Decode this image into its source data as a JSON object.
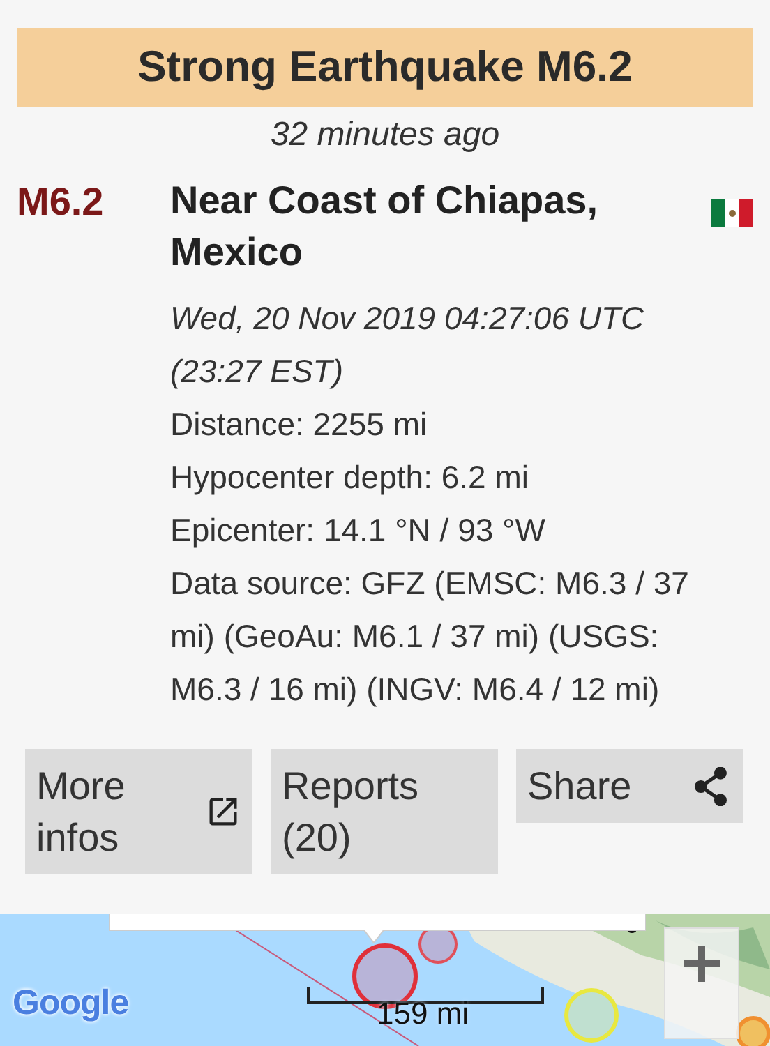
{
  "header": {
    "title": "Strong Earthquake M6.2",
    "time_ago": "32 minutes ago"
  },
  "quake": {
    "magnitude": "M6.2",
    "location": "Near Coast of Chiapas, Mexico",
    "datetime": "Wed, 20 Nov 2019 04:27:06 UTC (23:27 EST)",
    "details": [
      "Distance: 2255 mi",
      "Hypocenter depth: 6.2 mi",
      "Epicenter: 14.1 °N / 93 °W",
      "Data source: GFZ (EMSC: M6.3 / 37 mi) (GeoAu: M6.1 / 37 mi) (USGS: M6.3 / 16 mi) (INGV: M6.4 / 12 mi)"
    ]
  },
  "buttons": [
    {
      "label": "More infos",
      "kind": "external"
    },
    {
      "label": "Reports (20)",
      "kind": "plain"
    },
    {
      "label": "Share",
      "kind": "share"
    }
  ],
  "map": {
    "kind": "picture",
    "logo": "Google",
    "scale": "159 mi"
  }
}
